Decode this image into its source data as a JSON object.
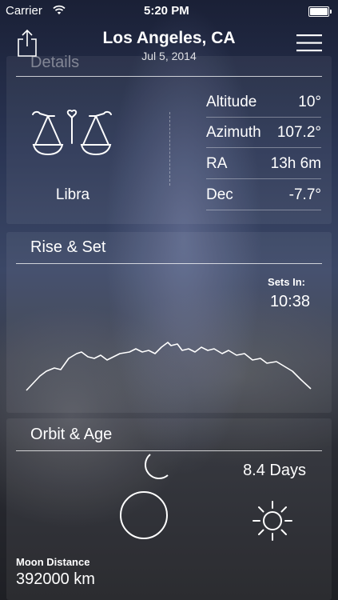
{
  "status_bar": {
    "carrier": "Carrier",
    "time": "5:20 PM"
  },
  "header": {
    "title": "Los Angeles, CA",
    "date": "Jul 5, 2014"
  },
  "details": {
    "title": "Details",
    "constellation": "Libra",
    "rows": [
      {
        "label": "Altitude",
        "value": "10°"
      },
      {
        "label": "Azimuth",
        "value": "107.2°"
      },
      {
        "label": "RA",
        "value": "13h 6m"
      },
      {
        "label": "Dec",
        "value": "-7.7°"
      }
    ]
  },
  "rise_set": {
    "title": "Rise & Set",
    "sets_in_label": "Sets In:",
    "sets_in_value": "10:38"
  },
  "orbit": {
    "title": "Orbit & Age",
    "age": "8.4 Days"
  },
  "moon_distance": {
    "label": "Moon Distance",
    "value": "392000 km"
  },
  "icons": [
    "wifi-icon",
    "battery-icon",
    "share-icon",
    "menu-icon",
    "libra-icon",
    "mountain-range-icon",
    "crescent-moon-icon",
    "full-moon-icon",
    "sun-icon"
  ]
}
